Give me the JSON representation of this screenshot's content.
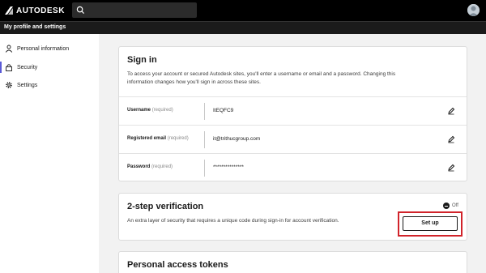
{
  "app": {
    "logo_text": "AUTODESK",
    "search_placeholder": ""
  },
  "subheader": {
    "title": "My profile and settings"
  },
  "sidebar": {
    "items": [
      {
        "label": "Personal information",
        "icon": "person-icon",
        "active": false
      },
      {
        "label": "Security",
        "icon": "lock-icon",
        "active": true
      },
      {
        "label": "Settings",
        "icon": "gear-icon",
        "active": false
      }
    ]
  },
  "signin": {
    "title": "Sign in",
    "description_line1": "To access your account or secured Autodesk sites, you'll enter a username or email and a password. Changing this",
    "description_line2": "information changes how you'll sign in across these sites.",
    "rows": [
      {
        "label": "Username",
        "required": "(required)",
        "value": "ItEQFC9"
      },
      {
        "label": "Registered email",
        "required": "(required)",
        "value": "it@trithucgroup.com"
      },
      {
        "label": "Password",
        "required": "(required)",
        "value": "***************"
      }
    ]
  },
  "two_step": {
    "title": "2-step verification",
    "status": "Off",
    "description": "An extra layer of security that requires a unique code during sign-in for account verification.",
    "button_label": "Set up"
  },
  "tokens": {
    "title": "Personal access tokens"
  },
  "colors": {
    "accent": "#5a5ad6",
    "highlight": "#d1232a",
    "topbar": "#000000"
  }
}
